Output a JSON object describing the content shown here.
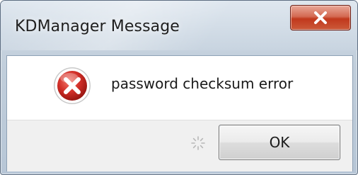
{
  "window": {
    "title": "KDManager Message"
  },
  "message": {
    "text": "password checksum error",
    "icon": "error-icon"
  },
  "buttons": {
    "ok_label": "OK",
    "close_icon": "close-icon"
  },
  "colors": {
    "close_button": "#c1381c",
    "error_icon_red": "#d22f28",
    "dialog_body": "#ffffff",
    "button_strip": "#f0f0f0"
  }
}
